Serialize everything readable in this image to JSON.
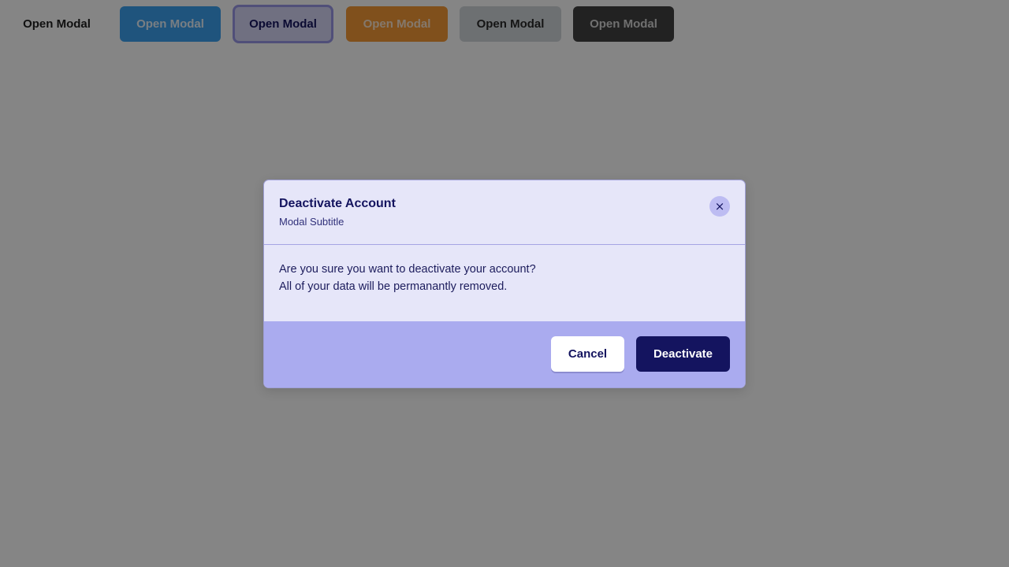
{
  "page_buttons": [
    {
      "label": "Open Modal",
      "variant": "plain"
    },
    {
      "label": "Open Modal",
      "variant": "blue"
    },
    {
      "label": "Open Modal",
      "variant": "outline"
    },
    {
      "label": "Open Modal",
      "variant": "orange"
    },
    {
      "label": "Open Modal",
      "variant": "gray"
    },
    {
      "label": "Open Modal",
      "variant": "dark"
    }
  ],
  "modal": {
    "title": "Deactivate Account",
    "subtitle": "Modal Subtitle",
    "close_icon": "×",
    "body_lines": [
      "Are you sure you want to deactivate your account?",
      "All of your data will be permanantly removed."
    ],
    "cancel_label": "Cancel",
    "confirm_label": "Deactivate"
  },
  "icons": {
    "close": "close-icon"
  },
  "colors": {
    "overlay": "#808080",
    "modal_background": "#e6e6f9",
    "modal_footer": "#aaabef",
    "primary": "#14145f",
    "blue": "#3da1ef",
    "orange": "#f59a36",
    "gray": "#d2d6db",
    "dark": "#424242"
  }
}
